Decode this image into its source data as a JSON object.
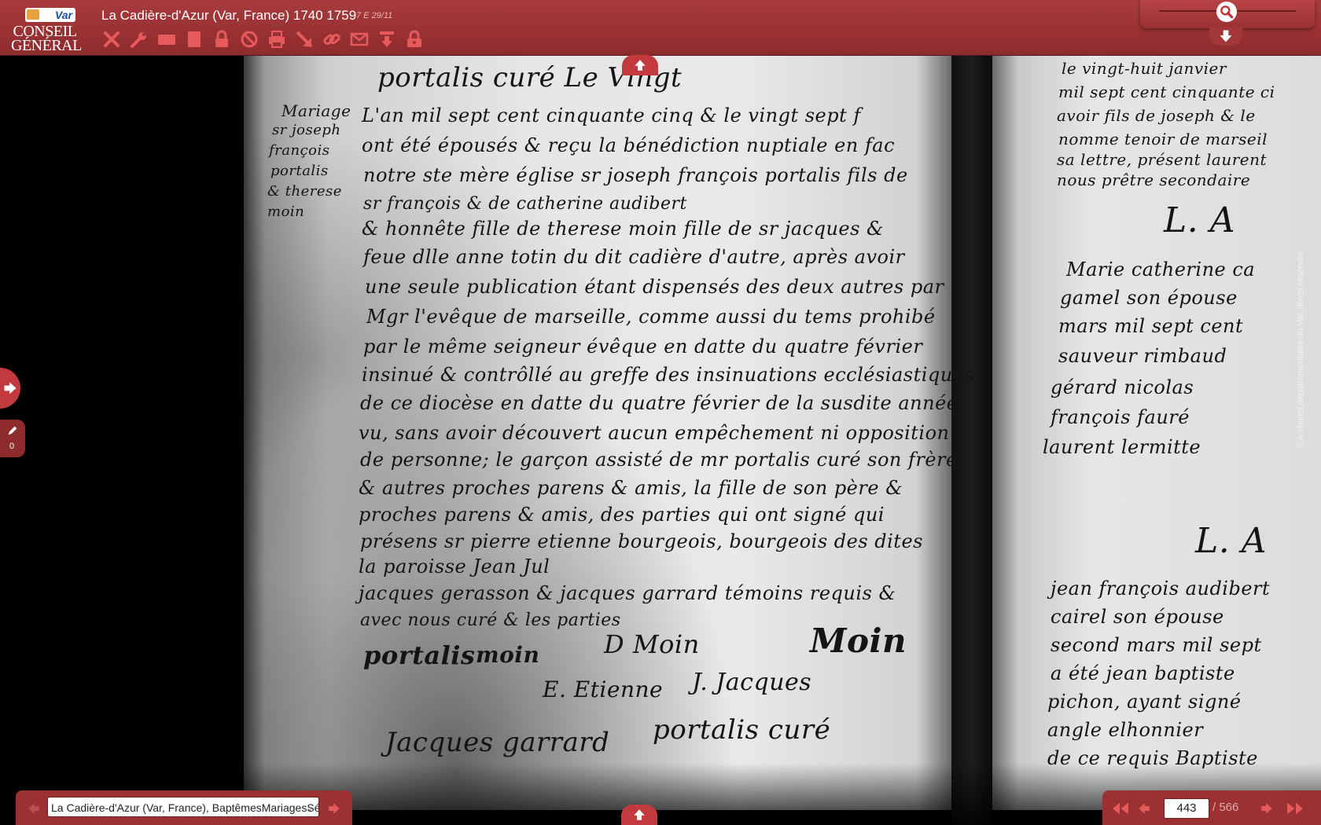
{
  "header": {
    "logo": {
      "badge": "Var",
      "line1": "CONSEIL",
      "line2": "GÉNÉRAL"
    },
    "title": "La Cadière-d'Azur (Var, France) 1740 1759",
    "cote": "7 E 29/11",
    "toolbar": [
      {
        "name": "close-icon"
      },
      {
        "name": "wrench-icon"
      },
      {
        "name": "single-page-view-icon"
      },
      {
        "name": "double-page-view-icon"
      },
      {
        "name": "lock-icon"
      },
      {
        "name": "forbidden-icon"
      },
      {
        "name": "print-icon"
      },
      {
        "name": "resize-icon"
      },
      {
        "name": "link-icon"
      },
      {
        "name": "mail-icon"
      },
      {
        "name": "download-icon"
      },
      {
        "name": "unlock-icon"
      }
    ]
  },
  "document": {
    "left_page_lines": [
      "portalis curé Le Vingt",
      "L'an mil sept cent cinquante cinq & le vingt sept f",
      "ont été épousés & reçu la bénédiction nuptiale en fac",
      "notre ste mère église sr joseph françois portalis fils de",
      "sr françois & de catherine audibert",
      "& honnête fille de therese moin fille de sr jacques &",
      "feue dlle anne totin du dit cadière d'autre, après avoir",
      "une seule publication étant dispensés des deux autres par",
      "Mgr l'evêque de marseille, comme aussi du tems prohibé",
      "par le même seigneur évêque en datte du quatre février",
      "insinué & contrôllé au greffe des insinuations ecclésiastiques",
      "de ce diocèse en datte du quatre février de la susdite année",
      "vu, sans avoir découvert aucun empêchement ni opposition",
      "de personne; le garçon assisté de mr portalis curé son frère",
      "& autres proches parens & amis, la fille de son père &",
      "proches parens & amis, des parties qui ont signé qui",
      "présens sr pierre etienne bourgeois, bourgeois des dites",
      "la paroisse                                     Jean Jul",
      "jacques gerasson & jacques garrard témoins requis &",
      "avec nous curé & les parties"
    ],
    "margin_note": [
      "Mariage",
      "sr joseph",
      "françois",
      "portalis",
      "& therese",
      "moin"
    ],
    "signatures": [
      "portalis",
      "moin",
      "D Moin",
      "Moin",
      "E. Etienne",
      "J. Jacques",
      "Jacques garrard",
      "portalis curé"
    ],
    "right_page_lines": [
      "le vingt-huit janvier",
      "mil sept cent cinquante ci",
      "avoir fils de joseph & le",
      "nomme tenoir de marseil",
      "sa lettre, présent laurent",
      "nous prêtre secondaire",
      "L. A",
      "Marie catherine ca",
      "gamel son épouse",
      "mars mil sept cent",
      "sauveur rimbaud",
      "gérard nicolas",
      "françois fauré",
      "laurent lermitte",
      "L. A",
      "jean françois audibert",
      "cairel son épouse",
      "second mars mil sept",
      "a été jean baptiste",
      "pichon, ayant signé",
      "angle elhonnier",
      "de ce requis      Baptiste"
    ],
    "watermark": "© Archives départementales du Var, droits réservés"
  },
  "sidebar": {
    "annotation_count": "0"
  },
  "footer": {
    "register": "La Cadière-d'Azur (Var, France), BaptêmesMariagesSépultures",
    "current_page": "443",
    "total_pages": "/ 566"
  },
  "colors": {
    "bar": "#9c3133",
    "accent": "#c23a3d",
    "icon": "#e65a5c"
  }
}
